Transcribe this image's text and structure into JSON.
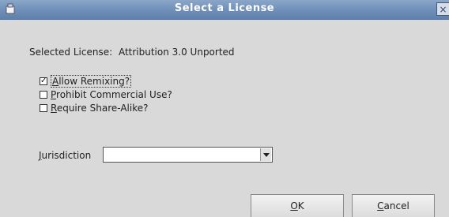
{
  "window": {
    "title": "Select a License",
    "close_glyph": "×",
    "app_icon": "app-icon",
    "close_icon": "close-icon"
  },
  "selected": {
    "label": "Selected License:",
    "value": "Attribution 3.0 Unported"
  },
  "options": [
    {
      "mnemonic": "A",
      "rest": "llow Remixing?",
      "checked": true,
      "check_glyph": "✓"
    },
    {
      "mnemonic": "P",
      "rest": "rohibit Commercial Use?",
      "checked": false,
      "check_glyph": ""
    },
    {
      "mnemonic": "R",
      "rest": "equire Share-Alike?",
      "checked": false,
      "check_glyph": ""
    }
  ],
  "jurisdiction": {
    "label_mnemonic": "J",
    "label_rest": "urisdiction",
    "value": ""
  },
  "buttons": {
    "ok_mnemonic": "O",
    "ok_rest": "K",
    "cancel_mnemonic": "C",
    "cancel_rest": "ancel"
  },
  "colors": {
    "titlebar": "#6f8fb8",
    "dialog_background": "#d9d9d9"
  }
}
